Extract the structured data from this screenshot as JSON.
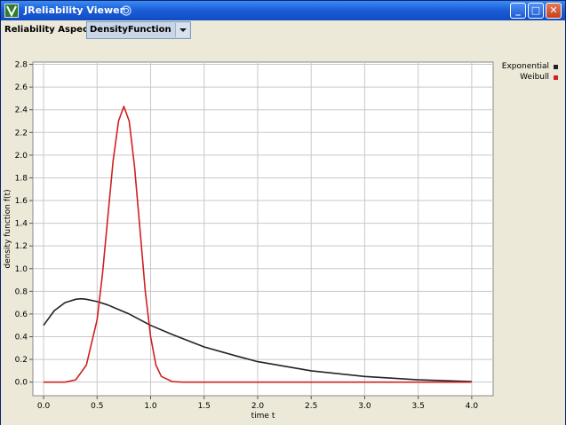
{
  "window": {
    "title": "JReliability Viewer",
    "buttons": {
      "minimize": "_",
      "maximize": "□",
      "close": "✕"
    }
  },
  "toolbar": {
    "aspect_label": "Reliability Aspect:",
    "aspect_value": "DensityFunction"
  },
  "colors": {
    "exponential": "#222222",
    "weibull": "#d02020",
    "grid": "#c8c8c8"
  },
  "chart_data": {
    "type": "line",
    "xlabel": "time t",
    "ylabel": "density function f(t)",
    "xlim": [
      -0.1,
      4.2
    ],
    "ylim": [
      -0.12,
      2.82
    ],
    "xticks": [
      0.0,
      0.5,
      1.0,
      1.5,
      2.0,
      2.5,
      3.0,
      3.5,
      4.0
    ],
    "xtick_labels": [
      "0.0",
      "0.5",
      "1.0",
      "1.5",
      "2.0",
      "2.5",
      "3.0",
      "3.5",
      "4.0"
    ],
    "yticks": [
      0.0,
      0.2,
      0.4,
      0.6,
      0.8,
      1.0,
      1.2,
      1.4,
      1.6,
      1.8,
      2.0,
      2.2,
      2.4,
      2.6,
      2.8
    ],
    "ytick_labels": [
      "0.0",
      "0.2",
      "0.4",
      "0.6",
      "0.8",
      "1.0",
      "1.2",
      "1.4",
      "1.6",
      "1.8",
      "2.0",
      "2.2",
      "2.4",
      "2.6",
      "2.8"
    ],
    "grid": true,
    "legend": "top-right",
    "series": [
      {
        "name": "Exponential",
        "x": [
          0.0,
          0.1,
          0.2,
          0.3,
          0.35,
          0.4,
          0.5,
          0.6,
          0.8,
          1.0,
          1.2,
          1.5,
          1.8,
          2.0,
          2.5,
          3.0,
          3.5,
          4.0
        ],
        "y": [
          0.5,
          0.63,
          0.7,
          0.73,
          0.735,
          0.73,
          0.71,
          0.68,
          0.6,
          0.5,
          0.42,
          0.31,
          0.23,
          0.18,
          0.1,
          0.05,
          0.02,
          0.005
        ]
      },
      {
        "name": "Weibull",
        "x": [
          0.0,
          0.2,
          0.3,
          0.4,
          0.5,
          0.55,
          0.6,
          0.65,
          0.7,
          0.75,
          0.8,
          0.85,
          0.9,
          0.95,
          1.0,
          1.05,
          1.1,
          1.2,
          1.3,
          1.5,
          2.0,
          3.0,
          4.0
        ],
        "y": [
          0.0,
          0.0,
          0.02,
          0.15,
          0.55,
          0.95,
          1.45,
          1.95,
          2.3,
          2.43,
          2.3,
          1.9,
          1.35,
          0.8,
          0.4,
          0.15,
          0.05,
          0.005,
          0.0,
          0.0,
          0.0,
          0.0,
          0.0
        ]
      }
    ]
  }
}
